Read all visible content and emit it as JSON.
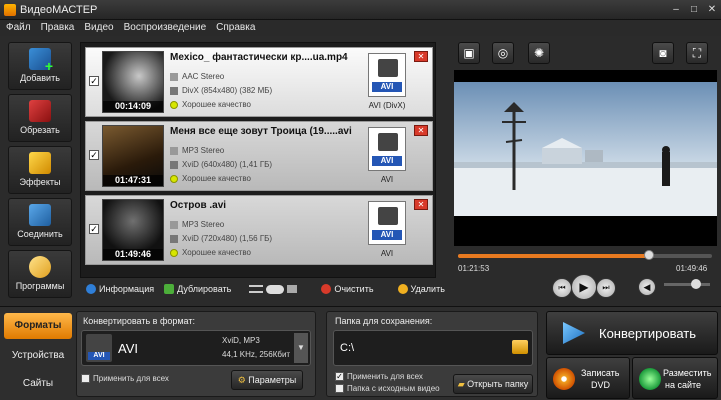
{
  "window": {
    "title": "ВидеоМАСТЕР",
    "min": "–",
    "max": "□",
    "close": "✕"
  },
  "menu": [
    "Файл",
    "Правка",
    "Видео",
    "Воспроизведение",
    "Справка"
  ],
  "tools": [
    {
      "label": "Добавить",
      "icon": "add-film-icon"
    },
    {
      "label": "Обрезать",
      "icon": "cut-film-icon"
    },
    {
      "label": "Эффекты",
      "icon": "effects-icon"
    },
    {
      "label": "Соединить",
      "icon": "join-icon"
    },
    {
      "label": "Программы",
      "icon": "programs-icon"
    }
  ],
  "files": [
    {
      "checked": "✓",
      "name": "Mexico_ фантастически кр....ua.mp4",
      "time": "00:14:09",
      "audio": "AAC Stereo",
      "video": "DivX (854x480) (382 МБ)",
      "quality": "Хорошее качество",
      "format_tag": "AVI",
      "format_label": "AVI (DivX)"
    },
    {
      "checked": "✓",
      "name": "Меня все еще зовут Троица  (19.....avi",
      "time": "01:47:31",
      "audio": "MP3 Stereo",
      "video": "XviD (640x480) (1,41 ГБ)",
      "quality": "Хорошее качество",
      "format_tag": "AVI",
      "format_label": "AVI"
    },
    {
      "checked": "✓",
      "name": "Остров .avi",
      "time": "01:49:46",
      "audio": "MP3 Stereo",
      "video": "XviD (720x480) (1,56 ГБ)",
      "quality": "Хорошее качество",
      "format_tag": "AVI",
      "format_label": "AVI"
    }
  ],
  "listbar": {
    "info": "Информация",
    "duplicate": "Дублировать",
    "clear": "Очистить",
    "delete": "Удалить"
  },
  "preview": {
    "current_time": "01:21:53",
    "total_time": "01:49:46",
    "progress": 0.75,
    "volume": 0.7
  },
  "bottom_tabs": {
    "formats": "Форматы",
    "devices": "Устройства",
    "sites": "Сайты"
  },
  "convert": {
    "title": "Конвертировать в формат:",
    "format": "AVI",
    "format_tag": "AVI",
    "codec": "XviD, MP3",
    "params": "44,1 KHz, 256Кбит",
    "apply_all": "Применить для всех",
    "settings_btn": "Параметры"
  },
  "save": {
    "title": "Папка для сохранения:",
    "path": "C:\\",
    "apply_all": "Применить для всех",
    "apply_all_checked": "✓",
    "source_folder": "Папка с исходным видео",
    "open_folder": "Открыть папку"
  },
  "actions": {
    "convert": "Конвертировать",
    "dvd_line1": "Записать",
    "dvd_line2": "DVD",
    "web_line1": "Разместить",
    "web_line2": "на сайте"
  },
  "colors": {
    "accent": "#e87a20",
    "avi_tag": "#2456b5",
    "quality_dot": "#d7e600"
  }
}
